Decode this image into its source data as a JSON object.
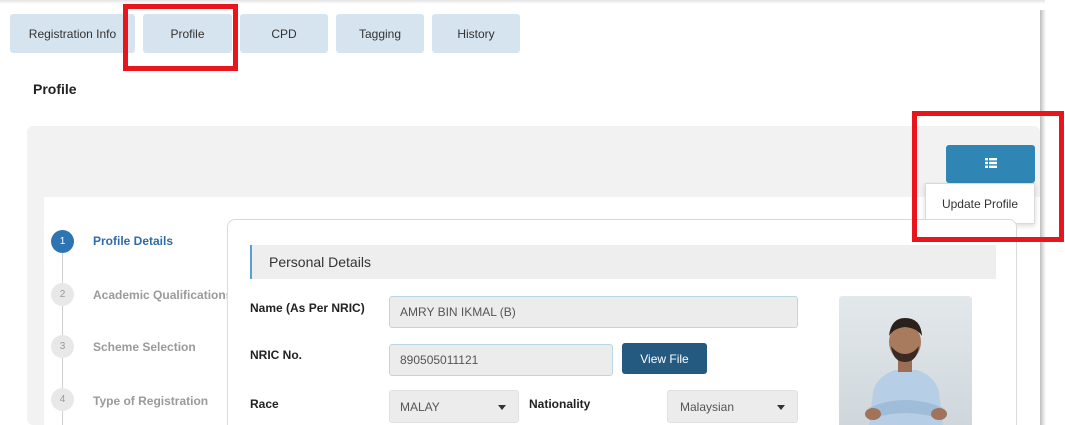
{
  "tabs": [
    {
      "label": "Registration Info"
    },
    {
      "label": "Profile"
    },
    {
      "label": "CPD"
    },
    {
      "label": "Tagging"
    },
    {
      "label": "History"
    }
  ],
  "page": {
    "title": "Profile"
  },
  "actions": {
    "menu_icon": "list-icon",
    "update_profile_label": "Update Profile"
  },
  "steps": [
    {
      "number": "1",
      "label": "Profile Details",
      "active": true
    },
    {
      "number": "2",
      "label": "Academic Qualifications",
      "active": false
    },
    {
      "number": "3",
      "label": "Scheme Selection",
      "active": false
    },
    {
      "number": "4",
      "label": "Type of Registration",
      "active": false
    }
  ],
  "personal": {
    "section_title": "Personal Details",
    "name_label": "Name (As Per NRIC)",
    "name_value": "AMRY BIN IKMAL (B)",
    "nric_label": "NRIC No.",
    "nric_value": "890505011121",
    "view_file_label": "View File",
    "race_label": "Race",
    "race_value": "MALAY",
    "nationality_label": "Nationality",
    "nationality_value": "Malaysian"
  },
  "colors": {
    "accent": "#2f86b4",
    "highlight": "#e8151d",
    "step_active": "#2f74b2"
  }
}
